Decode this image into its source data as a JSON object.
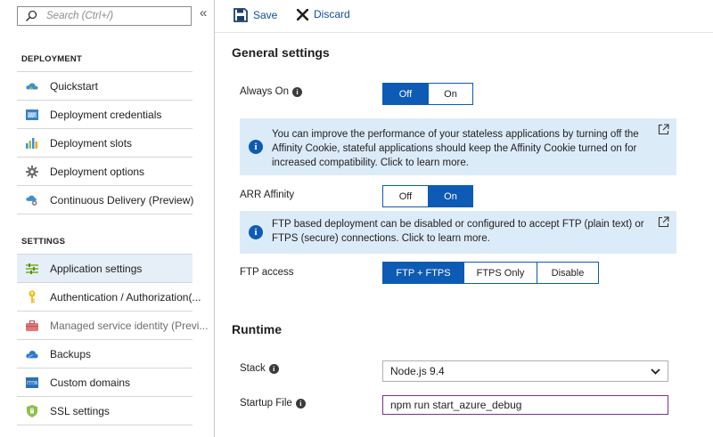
{
  "sidebar": {
    "search_placeholder": "Search (Ctrl+/)",
    "collapse_glyph": "«",
    "sections": {
      "deployment": "DEPLOYMENT",
      "settings": "SETTINGS"
    },
    "deployment_items": [
      {
        "label": "Quickstart",
        "icon": "cloud-icon"
      },
      {
        "label": "Deployment credentials",
        "icon": "credentials-icon"
      },
      {
        "label": "Deployment slots",
        "icon": "slots-chart-icon"
      },
      {
        "label": "Deployment options",
        "icon": "gear-icon"
      },
      {
        "label": "Continuous Delivery (Preview)",
        "icon": "cloud-delivery-icon"
      }
    ],
    "settings_items": [
      {
        "label": "Application settings",
        "icon": "settings-list-icon",
        "active": true
      },
      {
        "label": "Authentication / Authorization(...",
        "icon": "key-icon"
      },
      {
        "label": "Managed service identity (Previ...",
        "icon": "briefcase-icon"
      },
      {
        "label": "Backups",
        "icon": "cloud-backup-icon"
      },
      {
        "label": "Custom domains",
        "icon": "www-icon"
      },
      {
        "label": "SSL settings",
        "icon": "shield-icon"
      }
    ]
  },
  "toolbar": {
    "save_label": "Save",
    "discard_label": "Discard"
  },
  "general": {
    "heading": "General settings",
    "always_on": {
      "label": "Always On",
      "options": [
        "Off",
        "On"
      ],
      "selected": "Off"
    },
    "info_affinity": "You can improve the performance of your stateless applications by turning off the Affinity Cookie, stateful applications should keep the Affinity Cookie turned on for increased compatibility. Click to learn more.",
    "arr_affinity": {
      "label": "ARR Affinity",
      "options": [
        "Off",
        "On"
      ],
      "selected": "On"
    },
    "info_ftp": "FTP based deployment can be disabled or configured to accept FTP (plain text) or FTPS (secure) connections. Click to learn more.",
    "ftp_access": {
      "label": "FTP access",
      "options": [
        "FTP + FTPS",
        "FTPS Only",
        "Disable"
      ],
      "selected": "FTP + FTPS"
    }
  },
  "runtime": {
    "heading": "Runtime",
    "stack": {
      "label": "Stack",
      "value": "Node.js 9.4"
    },
    "startup_file": {
      "label": "Startup File",
      "value": "npm run start_azure_debug"
    }
  },
  "colors": {
    "accent": "#0d5bb5",
    "info_bg": "#dcebf8",
    "link": "#0e4fa3",
    "active_nav_bg": "#e6eef8",
    "focus_border": "#7a2f93"
  }
}
